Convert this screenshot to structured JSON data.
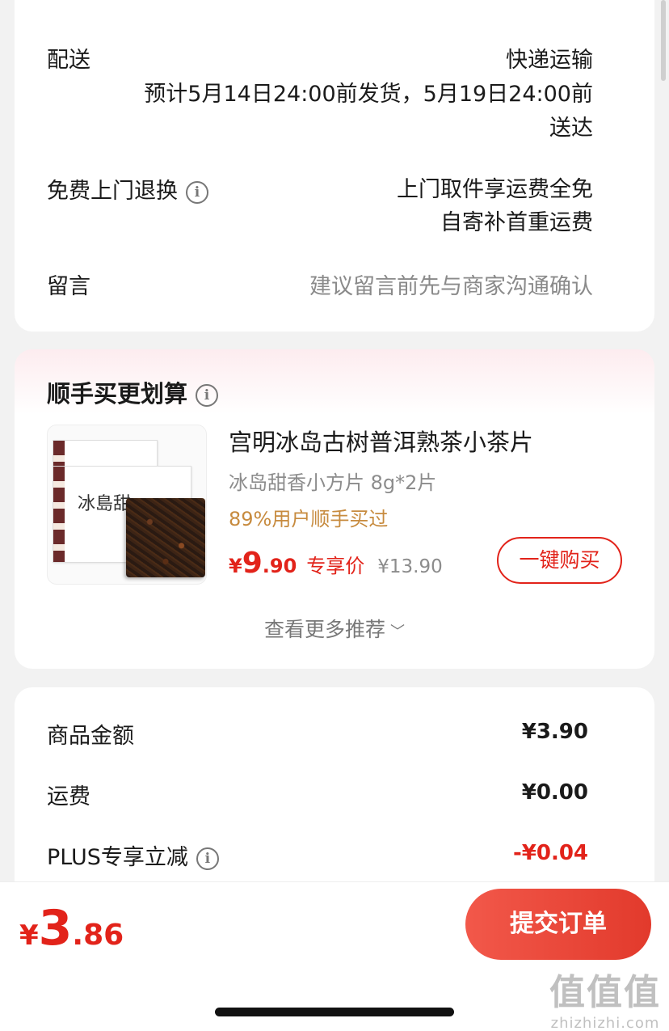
{
  "delivery": {
    "label": "配送",
    "method": "快递运输",
    "schedule_line1": "预计5月14日24:00前发货，5月19日24:00前",
    "schedule_line2": "送达",
    "return_label": "免费上门退换",
    "return_line1": "上门取件享运费全免",
    "return_line2": "自寄补首重运费",
    "message_label": "留言",
    "message_placeholder": "建议留言前先与商家沟通确认"
  },
  "addon": {
    "title": "顺手买更划算",
    "product": {
      "image_text": "冰島甜",
      "name": "宫明冰岛古树普洱熟茶小茶片",
      "spec": "冰岛甜香小方片 8g*2片",
      "buyers": "89%用户顺手买过",
      "price_currency": "¥",
      "price_int": "9",
      "price_dec": ".90",
      "price_tag": "专享价",
      "original_price": "¥13.90",
      "buy_label": "一键购买"
    },
    "more_label": "查看更多推荐"
  },
  "summary": {
    "items": [
      {
        "label": "商品金额",
        "value": "¥3.90"
      },
      {
        "label": "运费",
        "value": "¥0.00"
      },
      {
        "label": "PLUS专享立减",
        "value": "-¥0.04"
      }
    ]
  },
  "footer": {
    "total_currency": "¥",
    "total_int": "3",
    "total_dec": ".86",
    "submit_label": "提交订单"
  },
  "watermark": {
    "big": "值值值",
    "small": "zhizhizhi.com"
  },
  "colors": {
    "accent": "#e2231a",
    "gold": "#c78b3f",
    "background": "#f2f2f2"
  }
}
